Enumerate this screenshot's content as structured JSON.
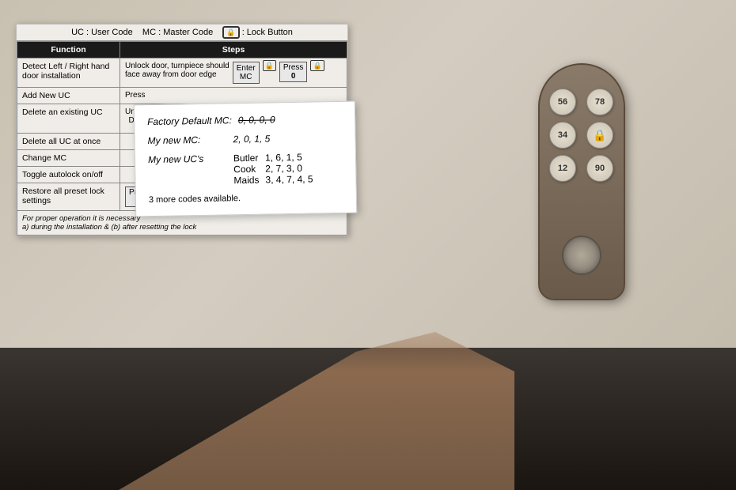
{
  "background": {
    "wall_color": "#c8c0b0",
    "floor_color": "#1a1510"
  },
  "legend": {
    "text": "UC : User Code    MC : Master Code    🔒 : Lock Button"
  },
  "table": {
    "headers": {
      "function": "Function",
      "steps": "Steps"
    },
    "rows": [
      {
        "function": "Detect Left / Right hand door installation",
        "steps": "Unlock door, turnpiece should face away from door edge | Enter MC | Press 🔒 | Press 0 | 🔒"
      },
      {
        "function": "Add New UC",
        "steps": "Press ..."
      },
      {
        "function": "Delete an existing UC",
        "steps": "Unlock Door | Enter MC"
      },
      {
        "function": "Delete all UC at once",
        "steps": ""
      },
      {
        "function": "Change MC",
        "steps": ""
      },
      {
        "function": "Toggle autolock on/off",
        "steps": ""
      },
      {
        "function": "Restore all preset lock settings",
        "steps": "Press R | Pre..."
      },
      {
        "function": "For proper operation it is necessary a) during the installation & (b) after resetting the lock",
        "steps": ""
      }
    ]
  },
  "sticky_note": {
    "factory_default_label": "Factory Default MC:",
    "factory_default_value": "0, 0, 0, 0",
    "my_new_mc_label": "My new MC:",
    "my_new_mc_value": "2, 0, 1, 5",
    "my_new_ucs_label": "My new UC's",
    "users": [
      {
        "name": "Butler",
        "code": "1, 6, 1, 5"
      },
      {
        "name": "Cook",
        "code": "2, 7, 3, 0"
      },
      {
        "name": "Maids",
        "code": "3, 4, 7, 4, 5"
      }
    ],
    "more_codes": "3 more codes available."
  },
  "lock_device": {
    "buttons": [
      "56",
      "78",
      "34",
      "🔒",
      "12",
      "90"
    ],
    "has_cylinder": true
  }
}
